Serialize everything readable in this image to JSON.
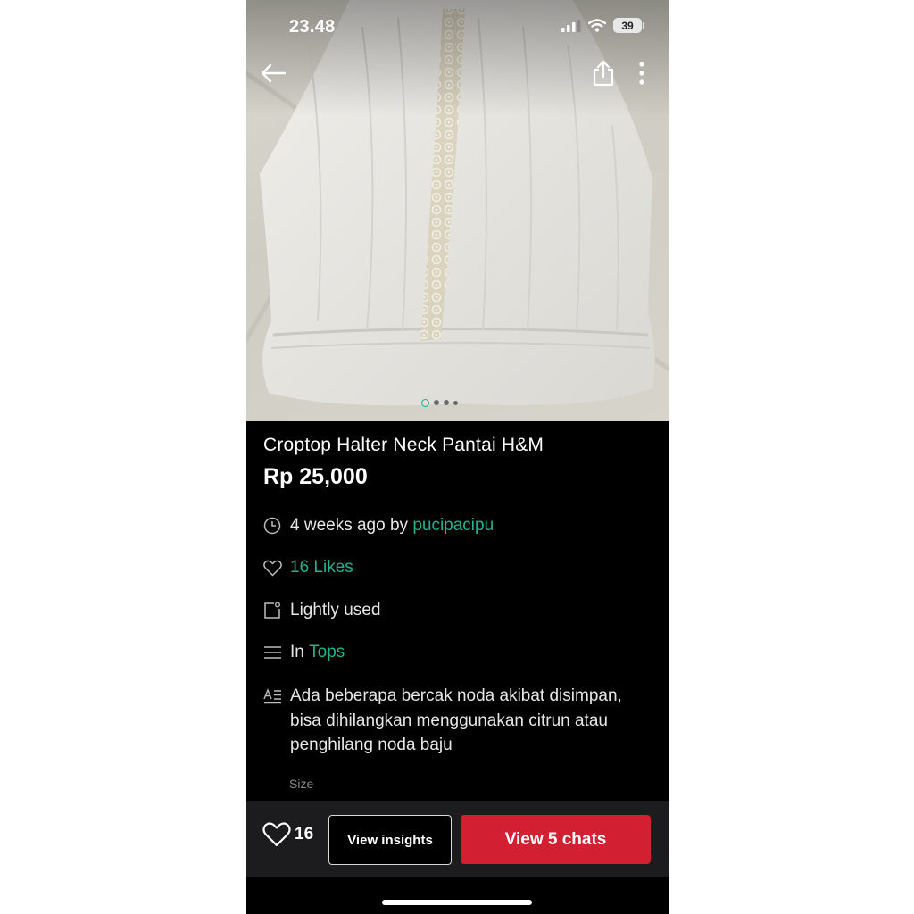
{
  "status_bar": {
    "time": "23.48",
    "battery": "39"
  },
  "header": {
    "back_icon": "arrow-left-icon",
    "share_icon": "share-icon",
    "more_icon": "more-vertical-icon"
  },
  "carousel": {
    "image_count": 4,
    "active_index": 0
  },
  "listing": {
    "title": "Croptop Halter Neck Pantai H&M",
    "price": "Rp 25,000",
    "posted_prefix": "4 weeks ago by ",
    "seller": "pucipacipu",
    "likes_text": "16 Likes",
    "condition": "Lightly used",
    "category_prefix": "In ",
    "category": "Tops",
    "description": "Ada beberapa bercak noda akibat disimpan, bisa dihilangkan menggunakan citrun atau penghilang noda baju",
    "size_label": "Size"
  },
  "bottom_bar": {
    "like_count": "16",
    "insights_label": "View insights",
    "chats_label": "View 5 chats"
  },
  "colors": {
    "accent_green": "#1fb38f",
    "chat_red": "#d21f32",
    "background": "#000000"
  }
}
